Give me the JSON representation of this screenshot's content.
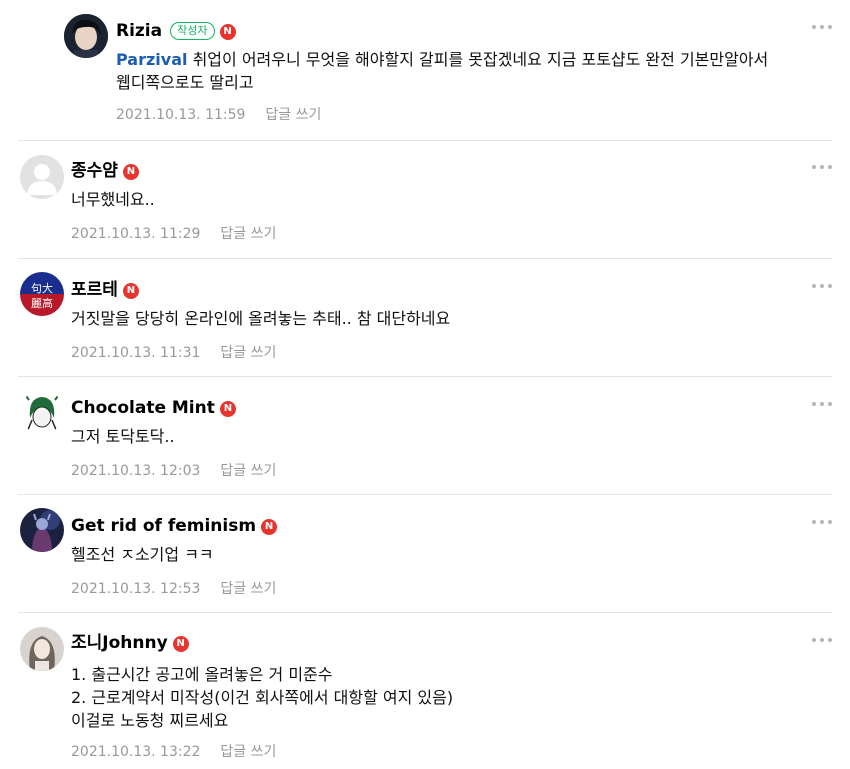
{
  "comments": [
    {
      "author": "Rizia",
      "author_badge": "작성자",
      "naver_badge": "N",
      "mention": "Parzival",
      "line1": " 취업이 어려우니 무엇을 해야할지 갈피를 못잡겠네요 지금 포토샵도 완전 기본만알아서",
      "line2": "웹디쪽으로도 딸리고",
      "date": "2021.10.13. 11:59",
      "reply": "답글 쓰기"
    },
    {
      "author": "종수얌",
      "naver_badge": "N",
      "line1": "너무했네요..",
      "date": "2021.10.13. 11:29",
      "reply": "답글 쓰기"
    },
    {
      "author": "포르테",
      "naver_badge": "N",
      "avatar_text": "句大麗高",
      "line1": "거짓말을 당당히 온라인에 올려놓는 추태.. 참 대단하네요",
      "date": "2021.10.13. 11:31",
      "reply": "답글 쓰기"
    },
    {
      "author": "Chocolate Mint",
      "naver_badge": "N",
      "line1": "그저 토닥토닥..",
      "date": "2021.10.13. 12:03",
      "reply": "답글 쓰기"
    },
    {
      "author": "Get rid of feminism",
      "naver_badge": "N",
      "line1": "헬조선 ㅈ소기업 ㅋㅋ",
      "date": "2021.10.13. 12:53",
      "reply": "답글 쓰기"
    },
    {
      "author": "조니Johnny",
      "naver_badge": "N",
      "line1": "1. 출근시간 공고에 올려놓은 거 미준수",
      "line2": "2. 근로계약서 미작성(이건 회사쪽에서 대항할 여지 있음)",
      "line3": "이걸로 노동청 찌르세요",
      "date": "2021.10.13. 13:22",
      "reply": "답글 쓰기"
    }
  ],
  "colors": {
    "naver_badge": "#e8342e",
    "author_badge": "#12b564",
    "mention": "#1e5db5",
    "meta": "#999999",
    "separator": "#e4e4e4"
  }
}
